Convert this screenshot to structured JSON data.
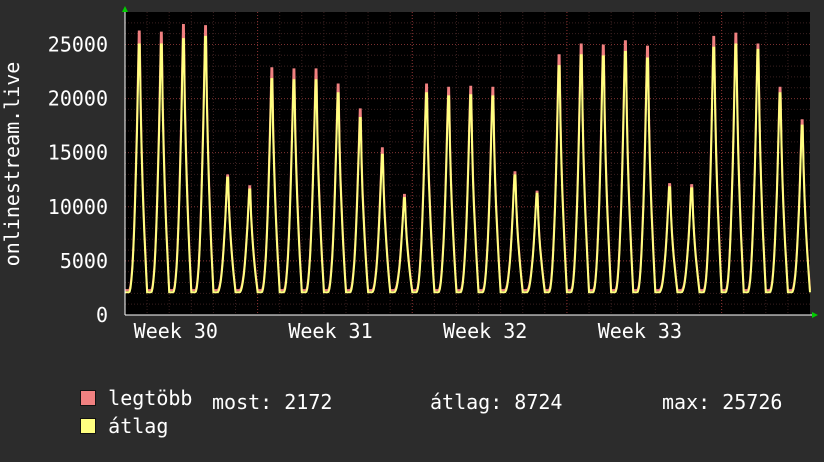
{
  "chart_data": {
    "type": "area",
    "ylabel": "onlinestream.live",
    "ylim": [
      0,
      28000
    ],
    "yticks": [
      0,
      5000,
      10000,
      15000,
      20000,
      25000
    ],
    "x_tick_labels": [
      "Week 30",
      "Week 31",
      "Week 32",
      "Week 33"
    ],
    "days_shown": 31,
    "grid": true,
    "legend_placement": "bottom",
    "colors": {
      "legtobb": "#f08080",
      "atlag": "#ffff80",
      "background": "#2c2c2c",
      "plot_background": "#000000",
      "grid": "#5a2a2a"
    },
    "series": [
      {
        "name": "legtöbb",
        "daily_peaks": [
          26200,
          26100,
          26800,
          26700,
          12900,
          11900,
          22800,
          22700,
          22700,
          21300,
          19000,
          15400,
          11100,
          21300,
          21000,
          21100,
          21000,
          13200,
          11400,
          24000,
          25000,
          24900,
          25300,
          24800,
          12100,
          12000,
          25700,
          26000,
          25000,
          21000,
          18000
        ]
      },
      {
        "name": "átlag",
        "daily_peaks": [
          25000,
          25000,
          25500,
          25700,
          12700,
          11600,
          21800,
          21700,
          21700,
          20500,
          18200,
          14800,
          10800,
          20500,
          20200,
          20300,
          20200,
          12900,
          11200,
          23000,
          24000,
          23900,
          24300,
          23700,
          11800,
          11700,
          24700,
          25000,
          24500,
          20500,
          17500
        ]
      }
    ]
  },
  "legend": {
    "max_label": "legtöbb",
    "avg_label": "átlag"
  },
  "stats": {
    "now": "most: 2172",
    "avg": "átlag: 8724",
    "max": "max: 25726"
  }
}
